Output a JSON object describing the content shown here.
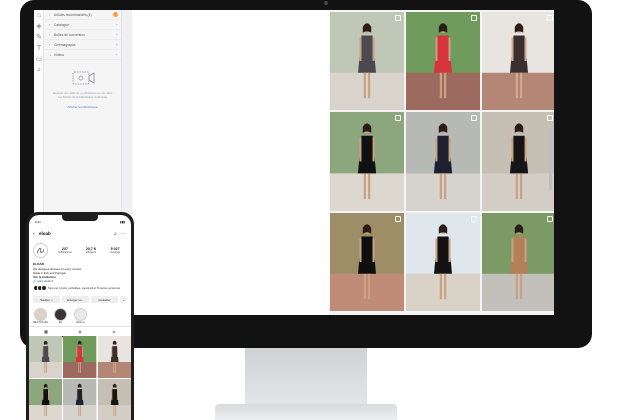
{
  "editor": {
    "panel_sections": [
      {
        "label": "Articles recommandés (4)",
        "badge": true
      },
      {
        "label": "Catalogue"
      },
      {
        "label": "Boîtes de conversion"
      },
      {
        "label": "Cinémagraphe"
      },
      {
        "label": "Vidéos"
      }
    ],
    "video_hint": "Déposez une vidéo ici, ou choisissez-en une dans vos fichiers de la bibliothèque multimédia",
    "video_link": "Afficher la bibliothèque",
    "toolbar_icons": [
      "home-icon",
      "layers-icon",
      "pen-icon",
      "text-icon",
      "image-icon",
      "search-icon"
    ]
  },
  "grid_photos": [
    {
      "bg": "#bfc8b6",
      "ground": "#d9d4cb",
      "dress": "#4a4a4f",
      "skin": "#c9a183"
    },
    {
      "bg": "#6f9b5c",
      "ground": "#9c6a5f",
      "dress": "#d8343e",
      "skin": "#c9a183"
    },
    {
      "bg": "#e8e4df",
      "ground": "#b48675",
      "dress": "#3a2f2f",
      "skin": "#d1a88c"
    },
    {
      "bg": "#8ca77e",
      "ground": "#dcd8d0",
      "dress": "#111111",
      "skin": "#c9a183"
    },
    {
      "bg": "#b7b9b5",
      "ground": "#d6d2cc",
      "dress": "#1c2030",
      "skin": "#c9a183"
    },
    {
      "bg": "#c6c0b4",
      "ground": "#d2cdc5",
      "dress": "#151515",
      "skin": "#c9a183"
    },
    {
      "bg": "#9e8e68",
      "ground": "#c08b77",
      "dress": "#0f0f0f",
      "skin": "#c9a183"
    },
    {
      "bg": "#dfe6ec",
      "ground": "#d9d2c6",
      "dress": "#121212",
      "skin": "#c9a183"
    },
    {
      "bg": "#7c9a66",
      "ground": "#c2c0ba",
      "dress": "#b48059",
      "skin": "#c9a183"
    }
  ],
  "phone": {
    "status_left": "9:41",
    "status_right": "▮▮▮",
    "username": "eloab",
    "profile_name": "ELOAB",
    "stats": [
      {
        "value": "237",
        "label": "publications"
      },
      {
        "value": "20,7 K",
        "label": "followers"
      },
      {
        "value": "5 027",
        "label": "suivi(e)s"
      }
    ],
    "bio_line1": "We designed dresses for every woman.",
    "bio_line2": "Made in Italy and Portugal",
    "bio_line3": "Voir la traduction",
    "link": "www.eloab.fr",
    "followed_by": "Suivi par cyrielle_euthalique, specsimili et 74 autres personnes",
    "buttons": [
      "Suivi(e) ⌄",
      "Envoyer un...",
      "Contacter",
      "⌄"
    ],
    "highlights": [
      "NEW COLLEC...",
      "Eté",
      "about us"
    ],
    "tabs": [
      "▦",
      "▣",
      "◉"
    ],
    "tiles": [
      {
        "bg": "#bfc8b6",
        "ground": "#d9d4cb",
        "dress": "#4a4a4f",
        "skin": "#c9a183"
      },
      {
        "bg": "#6f9b5c",
        "ground": "#9c6a5f",
        "dress": "#d8343e",
        "skin": "#c9a183"
      },
      {
        "bg": "#e8e4df",
        "ground": "#b48675",
        "dress": "#3a2f2f",
        "skin": "#d1a88c"
      },
      {
        "bg": "#8ca77e",
        "ground": "#dcd8d0",
        "dress": "#111111",
        "skin": "#c9a183"
      },
      {
        "bg": "#b7b9b5",
        "ground": "#d6d2cc",
        "dress": "#1c2030",
        "skin": "#c9a183"
      },
      {
        "bg": "#c6c0b4",
        "ground": "#d2cdc5",
        "dress": "#151515",
        "skin": "#c9a183"
      }
    ]
  },
  "colors": {
    "bezel": "#121212",
    "accent": "#f6a23a",
    "link": "#4a7bd1"
  }
}
